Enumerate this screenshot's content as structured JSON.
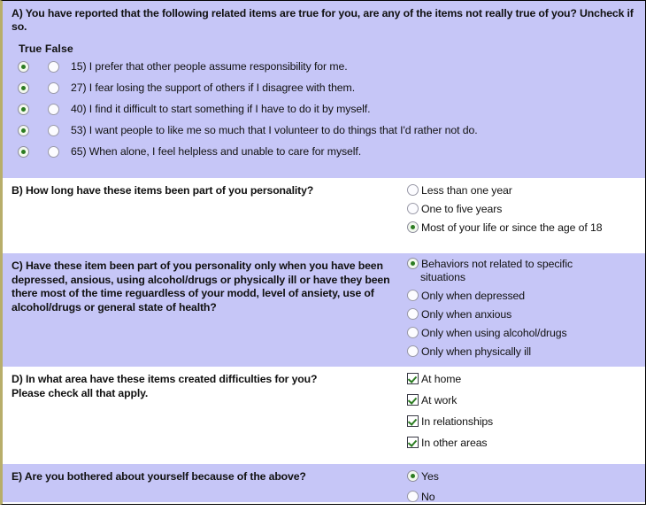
{
  "section_a": {
    "prompt": "A) You have reported that the following related items are true for you, are any of the items not really true of you? Uncheck if so.",
    "col_header": "True False",
    "col_true": "True",
    "col_false": "False",
    "items": [
      {
        "text": "15) I prefer that other people assume responsibility for me.",
        "answer": "true"
      },
      {
        "text": "27) I fear losing the support of others if I disagree with them.",
        "answer": "true"
      },
      {
        "text": "40) I find it difficult to start something if I have to do it by myself.",
        "answer": "true"
      },
      {
        "text": "53) I want people to like me so much that I volunteer to do things that I'd rather not do.",
        "answer": "true"
      },
      {
        "text": "65) When alone, I feel helpless and unable to care for myself.",
        "answer": "true"
      }
    ]
  },
  "section_b": {
    "question": "B) How long have these items been part of you personality?",
    "options": [
      {
        "label": "Less than one year",
        "selected": false
      },
      {
        "label": "One to five years",
        "selected": false
      },
      {
        "label": "Most of your life or since the age of 18",
        "selected": true
      }
    ]
  },
  "section_c": {
    "question": "C) Have these item been part of you personality only when you have been depressed, ansious, using alcohol/drugs or physically ill or have they been there most of the time reguardless of your modd, level of ansiety, use of alcohol/drugs or general state of health?",
    "options": [
      {
        "label": "Behaviors not related to specific situations",
        "selected": true
      },
      {
        "label": "Only when depressed",
        "selected": false
      },
      {
        "label": "Only when anxious",
        "selected": false
      },
      {
        "label": "Only when using alcohol/drugs",
        "selected": false
      },
      {
        "label": "Only when physically ill",
        "selected": false
      }
    ]
  },
  "section_d": {
    "question": "D) In what area have these items created difficulties for you?\nPlease check all that apply.",
    "question_line1": "D) In what area have these items created difficulties for you?",
    "question_line2": "Please check all that apply.",
    "options": [
      {
        "label": "At home",
        "checked": true
      },
      {
        "label": "At work",
        "checked": true
      },
      {
        "label": "In relationships",
        "checked": true
      },
      {
        "label": "In other areas",
        "checked": true
      }
    ]
  },
  "section_e": {
    "question": "E) Are you bothered about yourself because of the above?",
    "options": [
      {
        "label": "Yes",
        "selected": true
      },
      {
        "label": "No",
        "selected": false
      }
    ]
  },
  "colors": {
    "shaded_background": "#c6c6f7",
    "plain_background": "#ffffff",
    "accent_green": "#2c7c22",
    "border_left": "#b8ae6a",
    "text": "#111111"
  }
}
